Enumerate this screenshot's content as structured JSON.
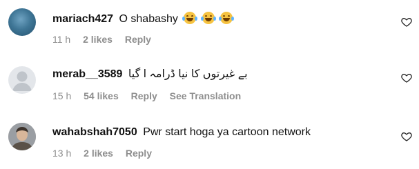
{
  "comments": [
    {
      "username": "mariach427",
      "text": "O shabashy",
      "emoji": "laughing-tears-emoji",
      "emoji_count": 3,
      "time": "11 h",
      "likes": "2 likes",
      "reply": "Reply"
    },
    {
      "username": "merab__3589",
      "text": "بے غیرتوں کا نیا ڈرامہ ا گیا",
      "time": "15 h",
      "likes": "54 likes",
      "reply": "Reply",
      "translation": "See Translation"
    },
    {
      "username": "wahabshah7050",
      "text": "Pwr start hoga ya cartoon network",
      "time": "13 h",
      "likes": "2 likes",
      "reply": "Reply"
    }
  ],
  "icons": {
    "like": "heart-outline-icon",
    "default_avatar": "default-user-avatar-icon"
  },
  "colors": {
    "muted_text": "#8e8e8e",
    "primary_text": "#111111"
  }
}
